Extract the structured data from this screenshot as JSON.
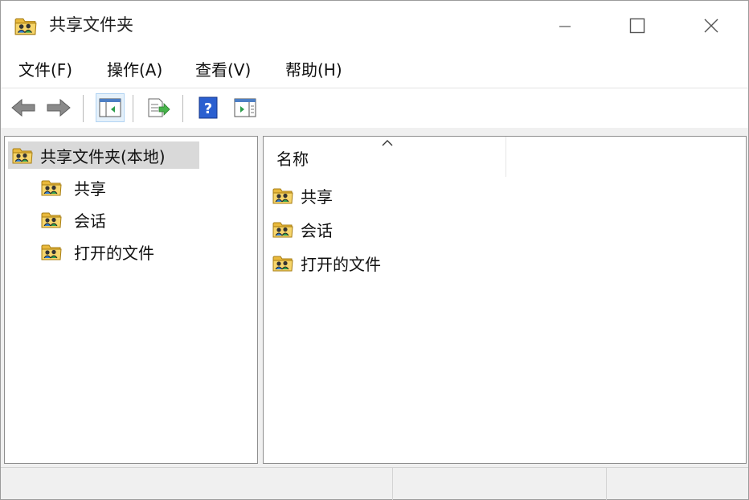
{
  "window": {
    "title": "共享文件夹",
    "icon": "shared-folder-icon"
  },
  "menu": {
    "file": "文件(F)",
    "action": "操作(A)",
    "view": "查看(V)",
    "help": "帮助(H)"
  },
  "toolbar": {
    "buttons": [
      "back-icon",
      "forward-icon",
      "show-hide-tree-icon",
      "export-list-icon",
      "help-icon",
      "show-hide-action-pane-icon"
    ]
  },
  "tree": {
    "root": "共享文件夹(本地)",
    "items": [
      {
        "label": "共享"
      },
      {
        "label": "会话"
      },
      {
        "label": "打开的文件"
      }
    ]
  },
  "list": {
    "column_name": "名称",
    "items": [
      {
        "label": "共享"
      },
      {
        "label": "会话"
      },
      {
        "label": "打开的文件"
      }
    ]
  },
  "colors": {
    "selection": "#d9d9d9",
    "toolbar_active": "#e5f1fb",
    "folder_yellow": "#f3cc5a",
    "help_blue": "#2a5fd0"
  }
}
